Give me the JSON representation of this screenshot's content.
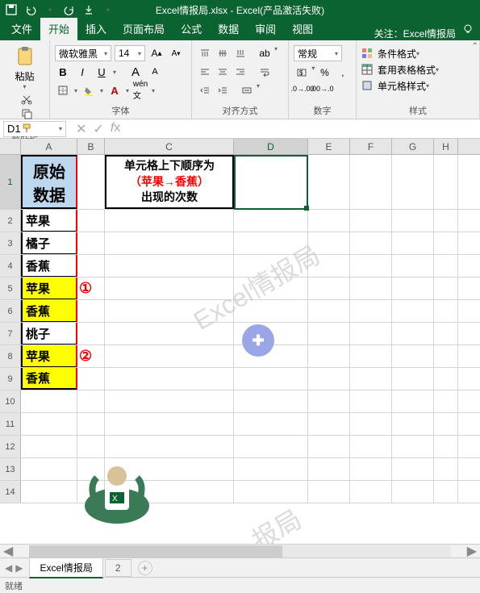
{
  "title": "Excel情报局.xlsx - Excel(产品激活失败)",
  "qat_icons": [
    "save-icon",
    "undo-icon",
    "redo-icon",
    "touch-icon"
  ],
  "tabs": [
    "文件",
    "开始",
    "插入",
    "页面布局",
    "公式",
    "数据",
    "审阅",
    "视图"
  ],
  "active_tab": "开始",
  "follow": "关注：Excel情报局",
  "ribbon": {
    "clipboard": {
      "label": "剪贴板",
      "paste": "粘贴"
    },
    "font": {
      "label": "字体",
      "name": "微软雅黑",
      "size": "14"
    },
    "align": {
      "label": "对齐方式"
    },
    "number": {
      "label": "数字",
      "format": "常规"
    },
    "styles": {
      "label": "样式",
      "cond": "条件格式",
      "table": "套用表格格式",
      "cell": "单元格样式"
    }
  },
  "namebox": "D1",
  "fx": "",
  "columns": [
    "A",
    "B",
    "C",
    "D",
    "E",
    "F",
    "G",
    "H"
  ],
  "data": {
    "A1": "原始\n数据",
    "A2": "苹果",
    "A3": "橘子",
    "A4": "香蕉",
    "A5": "苹果",
    "A6": "香蕉",
    "A7": "桃子",
    "A8": "苹果",
    "A9": "香蕉",
    "B5": "①",
    "B8": "②",
    "C1_l1": "单元格上下顺序为",
    "C1_l2": "（苹果→香蕉）",
    "C1_l3": "出现的次数"
  },
  "watermarks": [
    "Excel情报局",
    "报局"
  ],
  "sheets": [
    "Excel情报局",
    "2"
  ],
  "active_sheet": "Excel情报局",
  "status": "就绪"
}
